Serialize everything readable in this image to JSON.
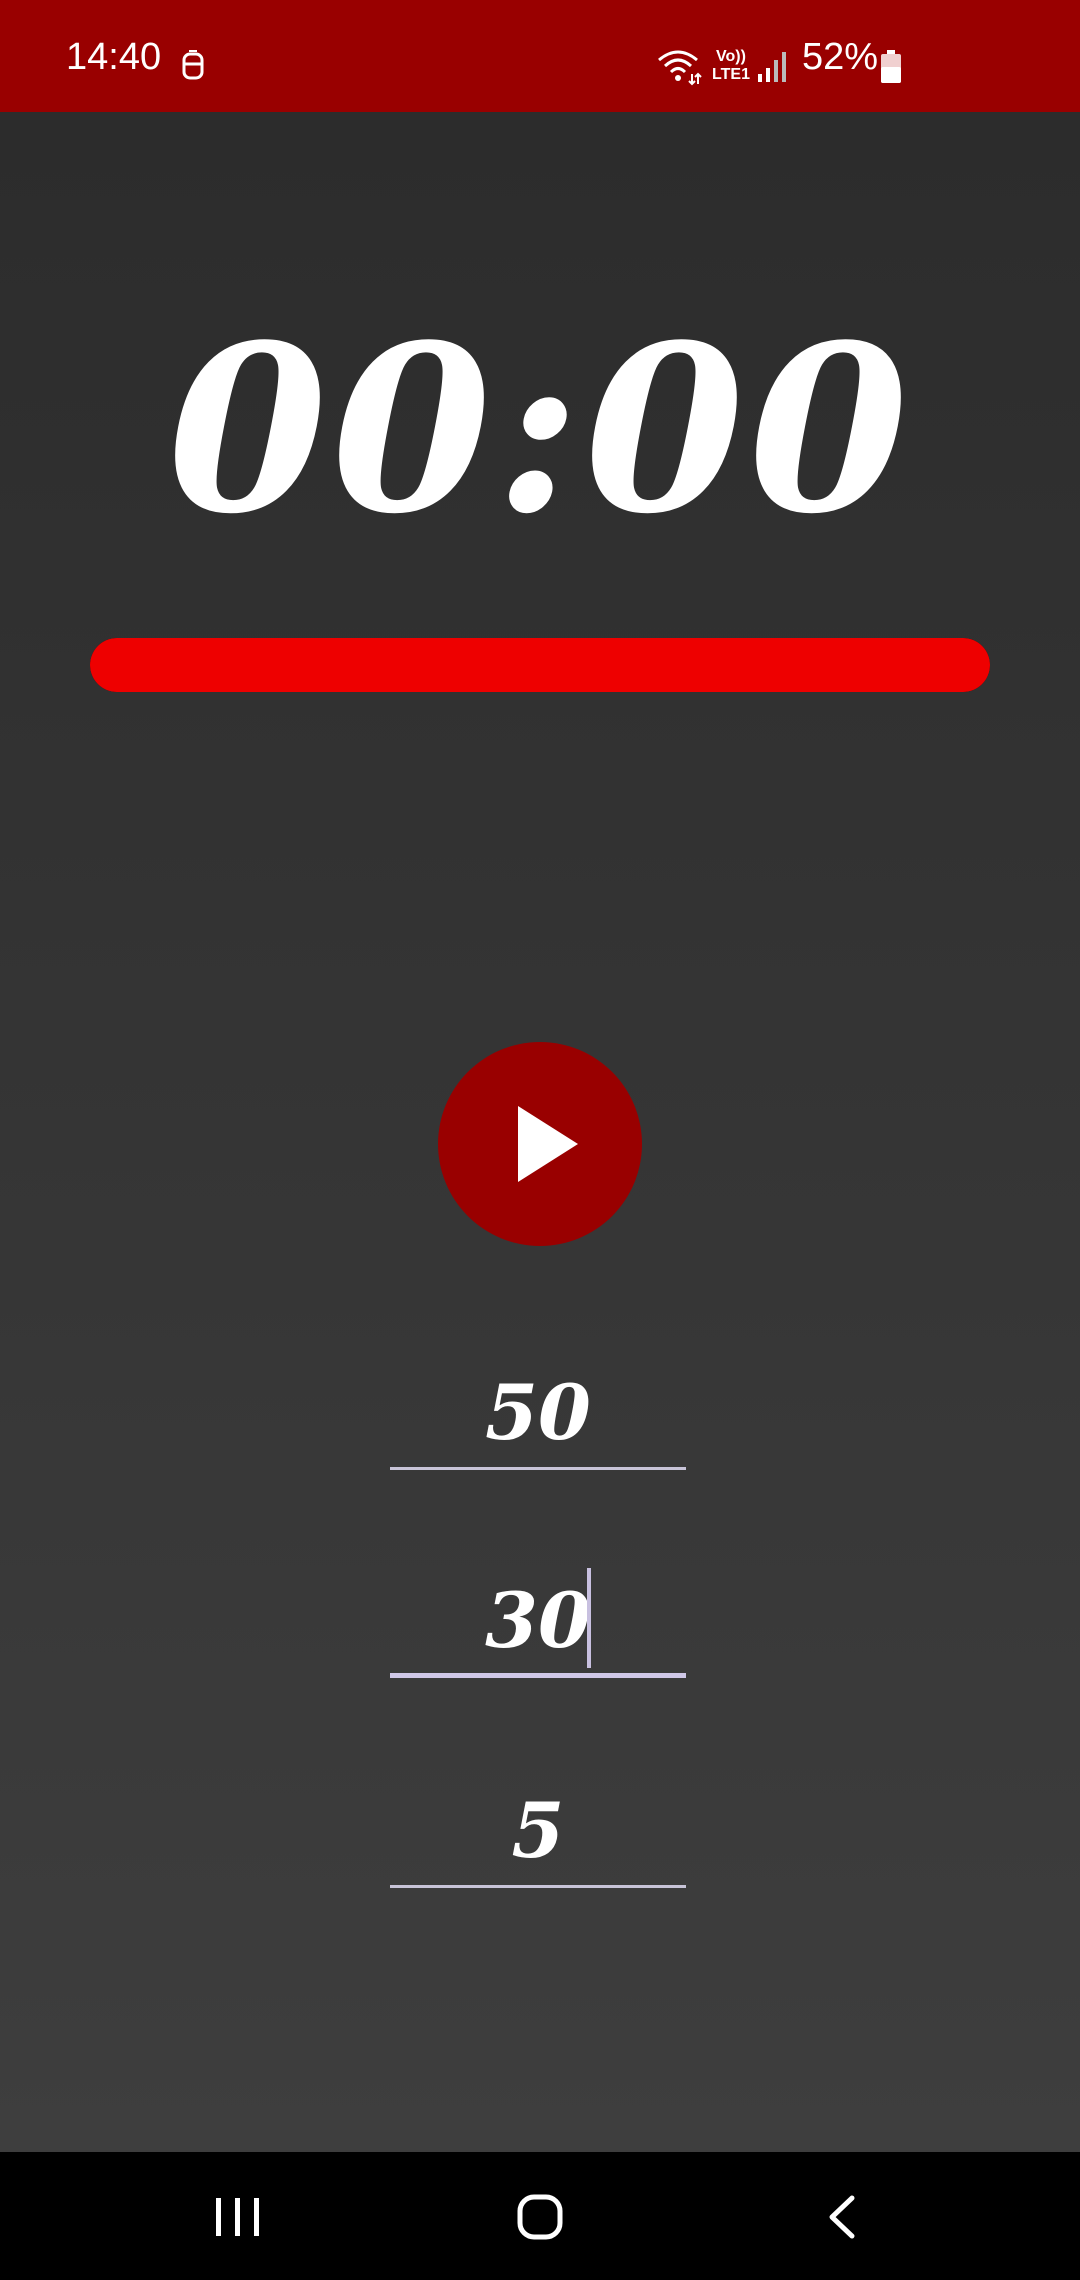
{
  "status_bar": {
    "time": "14:40",
    "volte_line1": "Vo))",
    "volte_line2": "LTE1",
    "battery": "52%",
    "background_color": "#990000"
  },
  "timer": {
    "display": "00:00",
    "progress_percent": 100,
    "progress_color": "#ee0000"
  },
  "controls": {
    "play_button_color": "#990000",
    "play_icon": "play-icon"
  },
  "fields": {
    "work_value": "50",
    "rest_value": "30",
    "rounds_value": "5",
    "focused_field": "rest"
  },
  "nav_bar": {
    "recents_icon": "recents-icon",
    "home_icon": "home-icon",
    "back_icon": "back-icon"
  }
}
